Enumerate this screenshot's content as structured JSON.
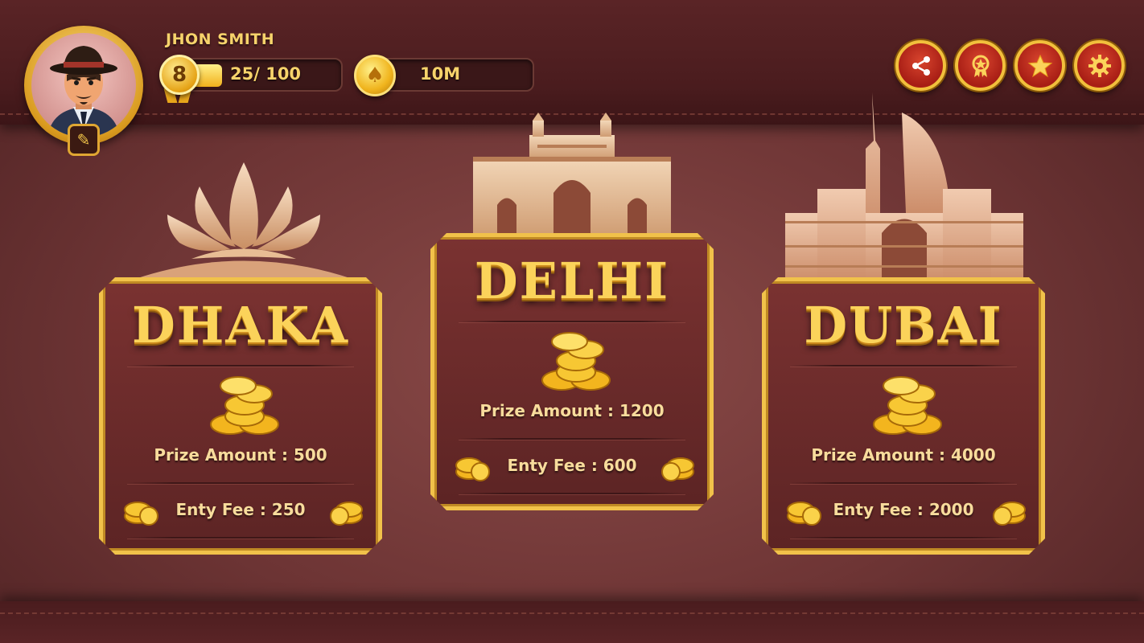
{
  "player": {
    "name": "JHON SMITH",
    "level": "8",
    "xp_text": "25/ 100",
    "xp_progress": 0.25,
    "coins": "10M"
  },
  "header_buttons": [
    {
      "name": "share-button",
      "icon": "share-icon"
    },
    {
      "name": "achievements-button",
      "icon": "medal-icon"
    },
    {
      "name": "rate-button",
      "icon": "star-icon"
    },
    {
      "name": "settings-button",
      "icon": "gear-icon"
    }
  ],
  "colors": {
    "gold": "#f1c24a",
    "button_red": "#b3241a",
    "card_bg": "#6b2b2b"
  },
  "rooms": [
    {
      "city": "DHAKA",
      "landmark": "lotus-icon",
      "prize_label": "Prize Amount : 500",
      "fee_label": "Enty Fee : 250"
    },
    {
      "city": "DELHI",
      "landmark": "india-gate-icon",
      "prize_label": "Prize Amount : 1200",
      "fee_label": "Enty Fee : 600"
    },
    {
      "city": "DUBAI",
      "landmark": "dubai-skyline-icon",
      "prize_label": "Prize Amount : 4000",
      "fee_label": "Enty Fee : 2000"
    }
  ]
}
